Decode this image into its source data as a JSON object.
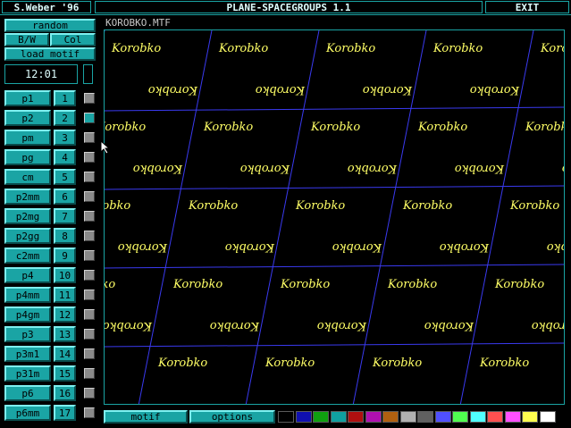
{
  "header": {
    "author": "S.Weber '96",
    "title": "PLANE-SPACEGROUPS 1.1",
    "exit_label": "EXIT"
  },
  "controls": {
    "random_label": "random",
    "bw_label": "B/W",
    "col_label": "Col",
    "load_motif_label": "load motif",
    "clock": "12:01"
  },
  "canvas": {
    "filename": "KOROBKO.MTF",
    "motif_text": "Korobko",
    "line_color": "#3a3af0",
    "motif_color": "#ffff66"
  },
  "groups": [
    {
      "name": "p1",
      "num": "1"
    },
    {
      "name": "p2",
      "num": "2"
    },
    {
      "name": "pm",
      "num": "3"
    },
    {
      "name": "pg",
      "num": "4"
    },
    {
      "name": "cm",
      "num": "5"
    },
    {
      "name": "p2mm",
      "num": "6"
    },
    {
      "name": "p2mg",
      "num": "7"
    },
    {
      "name": "p2gg",
      "num": "8"
    },
    {
      "name": "c2mm",
      "num": "9"
    },
    {
      "name": "p4",
      "num": "10"
    },
    {
      "name": "p4mm",
      "num": "11"
    },
    {
      "name": "p4gm",
      "num": "12"
    },
    {
      "name": "p3",
      "num": "13"
    },
    {
      "name": "p3m1",
      "num": "14"
    },
    {
      "name": "p31m",
      "num": "15"
    },
    {
      "name": "p6",
      "num": "16"
    },
    {
      "name": "p6mm",
      "num": "17"
    }
  ],
  "selected_group_index": 1,
  "bottom": {
    "motif_label": "motif",
    "options_label": "options"
  },
  "palette": [
    "#000000",
    "#1010b0",
    "#10a010",
    "#10a0a0",
    "#b01010",
    "#b010b0",
    "#b06010",
    "#b0b0b0",
    "#606060",
    "#5050ff",
    "#50ff50",
    "#50ffff",
    "#ff5050",
    "#ff50ff",
    "#ffff50",
    "#ffffff"
  ]
}
